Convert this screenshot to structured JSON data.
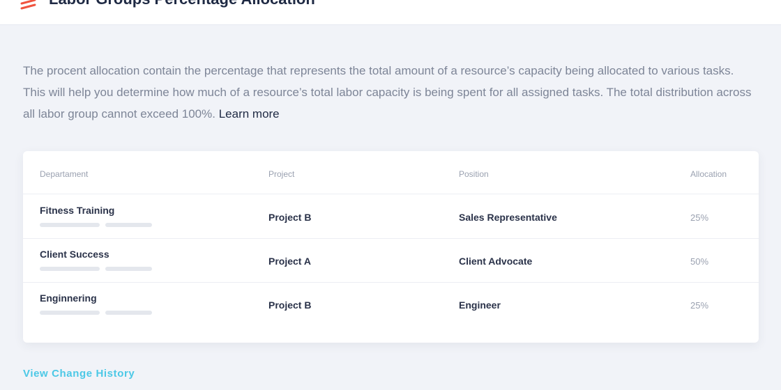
{
  "header": {
    "title": "Labor Groups Percentage Allocation",
    "logo_icon": "zigzag-logo-icon",
    "logo_color": "#f0533f"
  },
  "intro": {
    "text": "The procent allocation contain the percentage that represents the total amount of a resource’s capacity being allocated to various tasks. This will help you determine how much of a resource’s  total labor capacity is being spent for all assigned tasks. The total distribution across all labor group cannot exceed 100%.",
    "link_label": "Learn more"
  },
  "table": {
    "columns": [
      "Departament",
      "Project",
      "Position",
      "Allocation"
    ],
    "rows": [
      {
        "department": "Fitness Training",
        "project": "Project B",
        "position": "Sales Representative",
        "allocation": "25%"
      },
      {
        "department": "Client Success",
        "project": "Project A",
        "position": "Client Advocate",
        "allocation": "50%"
      },
      {
        "department": "Enginnering",
        "project": "Project B",
        "position": "Engineer",
        "allocation": "25%"
      }
    ]
  },
  "footer": {
    "history_link": "View Change History"
  },
  "colors": {
    "accent": "#4cc8e6",
    "background": "#f1f3f8",
    "text_primary": "#2a3249",
    "text_muted": "#7d8597"
  }
}
